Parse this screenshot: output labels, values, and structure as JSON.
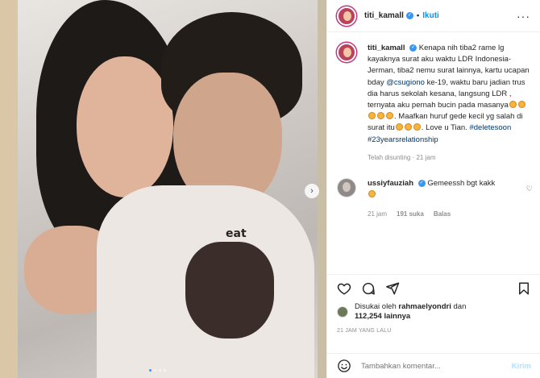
{
  "post": {
    "username": "titi_kamall",
    "follow_label": "Ikuti",
    "separator": "•",
    "caption_text": "Kenapa nih tiba2 rame lg kayaknya surat aku waktu LDR Indonesia-Jerman, tiba2 nemu surat lainnya, kartu ucapan bday",
    "caption_mention": "@csugiono",
    "caption_text2": "ke-19, waktu baru jadian trus dia harus sekolah kesana, langsung LDR , ternyata aku pernah bucin pada masanya",
    "caption_text3": ". Maafkan huruf gede kecil yg salah di surat itu",
    "caption_text4": ". Love u Tian.",
    "hashtag1": "#deletesoon",
    "hashtag2": "#23yearsrelationship",
    "edited": "Telah disunting · 21 jam",
    "photo_print_text": "eat"
  },
  "comment": {
    "username": "ussiyfauziah",
    "text": "Gemeessh bgt kakk",
    "time": "21 jam",
    "likes": "191 suka",
    "reply": "Balas"
  },
  "likes": {
    "prefix": "Disukai oleh",
    "user": "rahmaelyondri",
    "conj": "dan",
    "count": "112,254 lainnya"
  },
  "timestamp": "21 JAM YANG LALU",
  "add_comment": {
    "placeholder": "Tambahkan komentar...",
    "post_label": "Kirim"
  },
  "carousel": {
    "next_icon": "›"
  },
  "colors": {
    "link": "#00376b",
    "accent": "#0095f6",
    "verified": "#3897f0"
  }
}
